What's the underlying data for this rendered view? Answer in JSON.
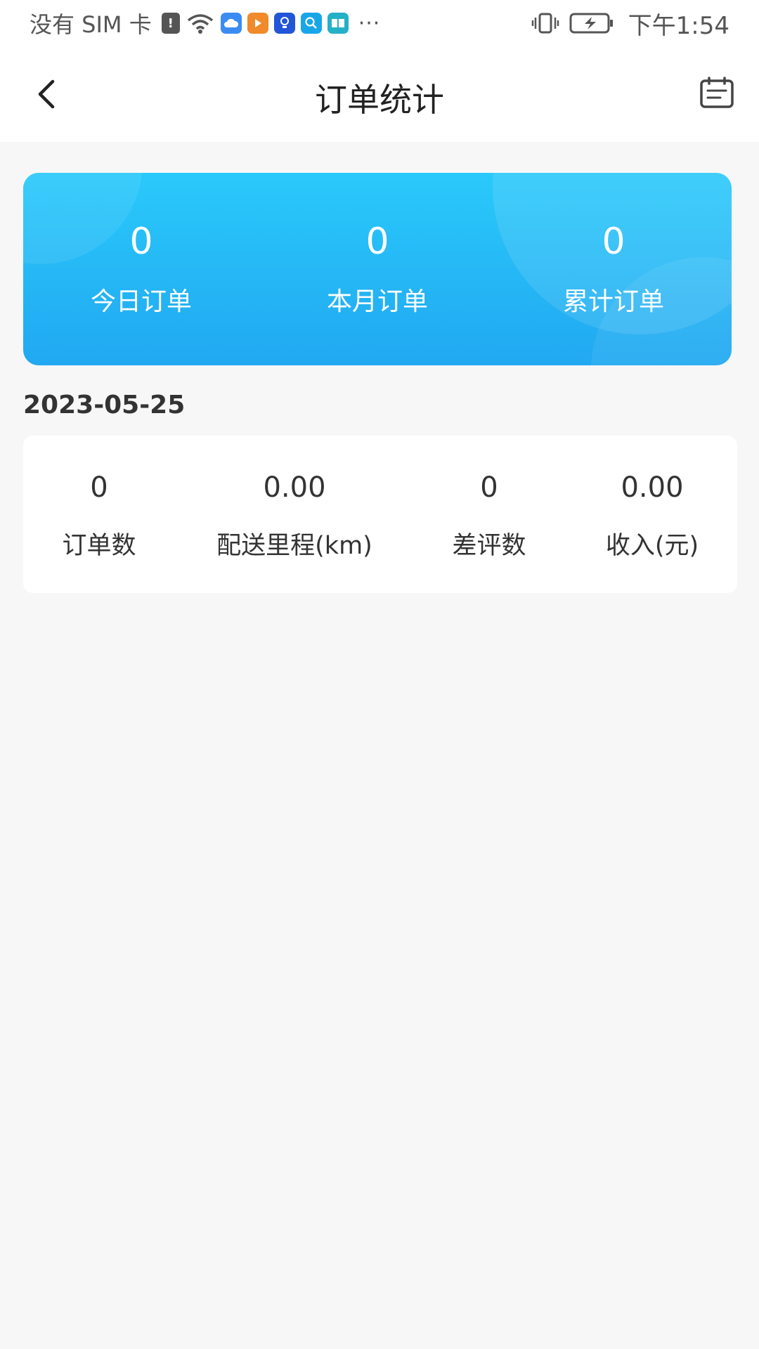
{
  "status_bar": {
    "carrier": "没有 SIM 卡",
    "more": "···",
    "time": "下午1:54",
    "icons": [
      "alert-icon",
      "wifi-icon",
      "cloud-icon",
      "video-icon",
      "bulb-icon",
      "search-app-icon",
      "book-icon",
      "vibrate-icon",
      "battery-charging-icon"
    ]
  },
  "header": {
    "title": "订单统计"
  },
  "summary": {
    "items": [
      {
        "value": "0",
        "label": "今日订单"
      },
      {
        "value": "0",
        "label": "本月订单"
      },
      {
        "value": "0",
        "label": "累计订单"
      }
    ]
  },
  "daily": {
    "date": "2023-05-25",
    "stats": [
      {
        "value": "0",
        "label": "订单数"
      },
      {
        "value": "0.00",
        "label": "配送里程(km)"
      },
      {
        "value": "0",
        "label": "差评数"
      },
      {
        "value": "0.00",
        "label": "收入(元)"
      }
    ]
  },
  "colors": {
    "card_gradient_top": "#2ac9fb",
    "card_gradient_bottom": "#21a8f1",
    "background": "#f7f7f7"
  }
}
